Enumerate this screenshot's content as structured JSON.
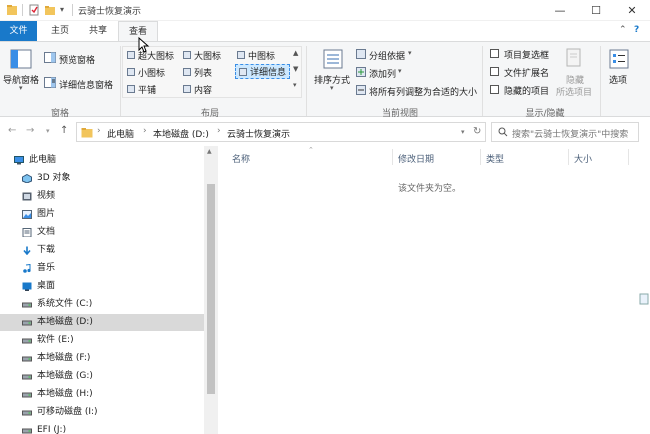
{
  "window": {
    "title": "云骑士恢复演示",
    "minimize": "—",
    "maximize": "☐",
    "close": "✕"
  },
  "tabs": {
    "file": "文件",
    "home": "主页",
    "share": "共享",
    "view": "查看"
  },
  "ribbon": {
    "panes": {
      "nav_pane": "导航窗格",
      "preview_pane": "预览窗格",
      "details_pane": "详细信息窗格",
      "group": "窗格"
    },
    "layout": {
      "extra_large": "超大图标",
      "large": "大图标",
      "medium": "中图标",
      "small": "小图标",
      "list": "列表",
      "details": "详细信息",
      "tiles": "平铺",
      "content": "内容",
      "group": "布局"
    },
    "current_view": {
      "sort_by": "排序方式",
      "group_by": "分组依据",
      "add_column": "添加列",
      "fit_columns": "将所有列调整为合适的大小",
      "group": "当前视图"
    },
    "show_hide": {
      "item_checkboxes": "项目复选框",
      "file_extensions": "文件扩展名",
      "hidden_items": "隐藏的项目",
      "hide": "隐藏",
      "hide_selected": "所选项目",
      "options": "选项",
      "group": "显示/隐藏"
    }
  },
  "address": {
    "crumbs": [
      "此电脑",
      "本地磁盘 (D:)",
      "云骑士恢复演示"
    ],
    "search_placeholder": "搜索\"云骑士恢复演示\"中搜索"
  },
  "nav": {
    "items": [
      {
        "label": "此电脑",
        "icon": "computer-icon"
      },
      {
        "label": "3D 对象",
        "icon": "3d-objects-icon"
      },
      {
        "label": "视频",
        "icon": "video-icon"
      },
      {
        "label": "图片",
        "icon": "pictures-icon"
      },
      {
        "label": "文档",
        "icon": "documents-icon"
      },
      {
        "label": "下载",
        "icon": "download-icon"
      },
      {
        "label": "音乐",
        "icon": "music-icon"
      },
      {
        "label": "桌面",
        "icon": "desktop-icon"
      },
      {
        "label": "系统文件 (C:)",
        "icon": "drive-icon"
      },
      {
        "label": "本地磁盘 (D:)",
        "icon": "drive-icon"
      },
      {
        "label": "软件 (E:)",
        "icon": "drive-icon"
      },
      {
        "label": "本地磁盘 (F:)",
        "icon": "drive-icon"
      },
      {
        "label": "本地磁盘 (G:)",
        "icon": "drive-icon"
      },
      {
        "label": "本地磁盘 (H:)",
        "icon": "drive-icon"
      },
      {
        "label": "可移动磁盘 (I:)",
        "icon": "drive-icon"
      },
      {
        "label": "EFI (J:)",
        "icon": "drive-icon"
      }
    ]
  },
  "content": {
    "columns": {
      "name": "名称",
      "date": "修改日期",
      "type": "类型",
      "size": "大小"
    },
    "empty_message": "该文件夹为空。"
  }
}
